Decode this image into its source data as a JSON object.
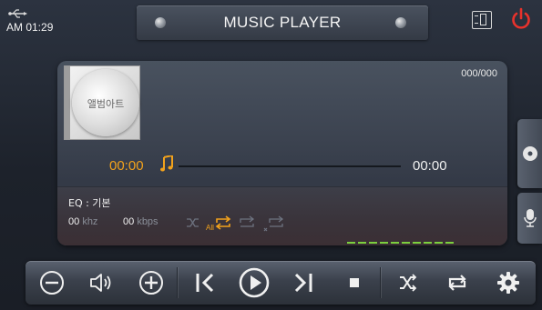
{
  "status": {
    "time": "AM 01:29",
    "usb_icon": "usb-icon"
  },
  "header": {
    "title": "MUSIC PLAYER",
    "mode_icon": "display-mode-icon",
    "power_icon": "power-icon"
  },
  "track": {
    "album_label": "앨범아트",
    "counter": "000/000",
    "current_time": "00:00",
    "total_time": "00:00",
    "progress": 0
  },
  "info": {
    "eq": "EQ : 기본",
    "khz_value": "00",
    "khz_unit": "khz",
    "kbps_value": "00",
    "kbps_unit": "kbps",
    "repeat_all_label": "All"
  },
  "side_tabs": [
    "disc-icon",
    "microphone-icon"
  ],
  "controls": [
    "volume-down",
    "volume-mute",
    "volume-up",
    "previous",
    "play",
    "next",
    "stop",
    "shuffle",
    "repeat",
    "settings"
  ],
  "colors": {
    "accent": "#f2a21c",
    "power": "#e8322c",
    "level": "#7ccf3e"
  }
}
